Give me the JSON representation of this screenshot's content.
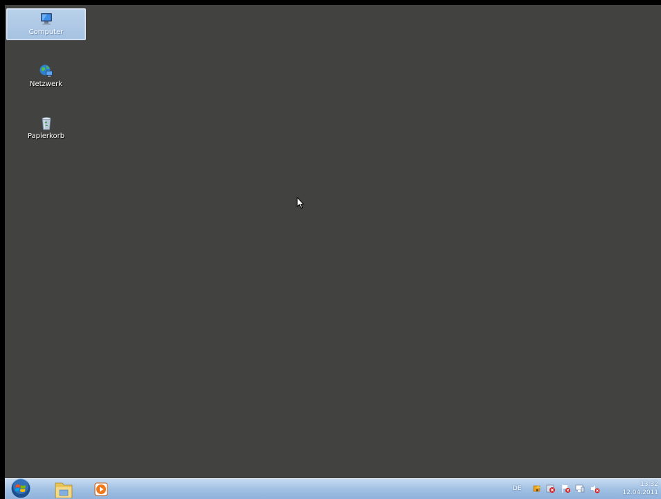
{
  "desktop": {
    "background_color": "#424340",
    "icons": [
      {
        "label": "Computer",
        "icon": "computer-icon",
        "selected": true
      },
      {
        "label": "Netzwerk",
        "icon": "network-icon",
        "selected": false
      },
      {
        "label": "Papierkorb",
        "icon": "recycle-bin-icon",
        "selected": false
      }
    ]
  },
  "taskbar": {
    "start": {
      "icon": "windows-start-orb-icon"
    },
    "pinned": [
      {
        "icon": "windows-explorer-icon"
      },
      {
        "icon": "media-player-icon"
      }
    ],
    "tray": {
      "language": "DE",
      "icons": [
        "network-warning-icon",
        "security-alert-icon",
        "action-center-flag-icon",
        "display-icon",
        "volume-muted-icon"
      ],
      "time": "13:32",
      "date": "12.04.2011"
    }
  }
}
